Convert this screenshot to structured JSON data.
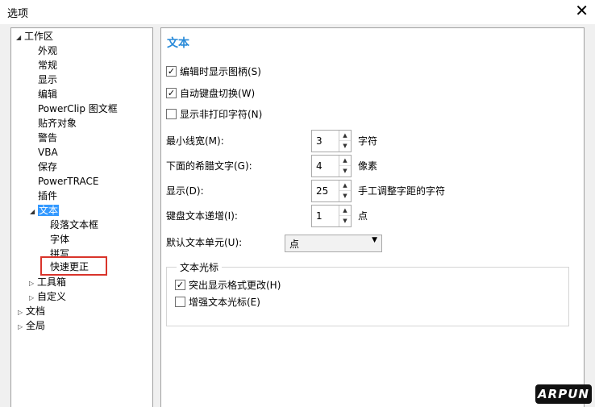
{
  "window": {
    "title": "选项",
    "close_glyph": "✕"
  },
  "tree": {
    "items": [
      {
        "label": "工作区",
        "toggle": "◢"
      },
      {
        "label": "外观"
      },
      {
        "label": "常规"
      },
      {
        "label": "显示"
      },
      {
        "label": "编辑"
      },
      {
        "label": "PowerClip 图文框"
      },
      {
        "label": "贴齐对象"
      },
      {
        "label": "警告"
      },
      {
        "label": "VBA"
      },
      {
        "label": "保存"
      },
      {
        "label": "PowerTRACE"
      },
      {
        "label": "插件"
      },
      {
        "label": "文本",
        "toggle": "◢",
        "selected": true
      },
      {
        "label": "段落文本框"
      },
      {
        "label": "字体"
      },
      {
        "label": "拼写"
      },
      {
        "label": "快速更正"
      },
      {
        "label": "工具箱",
        "toggle": "▷"
      },
      {
        "label": "自定义",
        "toggle": "▷"
      },
      {
        "label": "文档",
        "toggle": "▷"
      },
      {
        "label": "全局",
        "toggle": "▷"
      }
    ]
  },
  "panel": {
    "title": "文本",
    "checkboxes": [
      {
        "label": "编辑时显示图柄(S)",
        "checked": true
      },
      {
        "label": "自动键盘切换(W)",
        "checked": true
      },
      {
        "label": "显示非打印字符(N)",
        "checked": false
      }
    ],
    "fields": [
      {
        "label": "最小线宽(M):",
        "value": "3",
        "unit": "字符"
      },
      {
        "label": "下面的希腊文字(G):",
        "value": "4",
        "unit": "像素"
      },
      {
        "label": "显示(D):",
        "value": "25",
        "unit": "手工调整字距的字符"
      },
      {
        "label": "键盘文本递增(I):",
        "value": "1",
        "unit": "点"
      }
    ],
    "default_unit": {
      "label": "默认文本单元(U):",
      "value": "点"
    },
    "cursor_group": {
      "title": "文本光标",
      "checkboxes": [
        {
          "label": "突出显示格式更改(H)",
          "checked": true
        },
        {
          "label": "增强文本光标(E)",
          "checked": false
        }
      ]
    }
  },
  "watermark": "ARPUN"
}
